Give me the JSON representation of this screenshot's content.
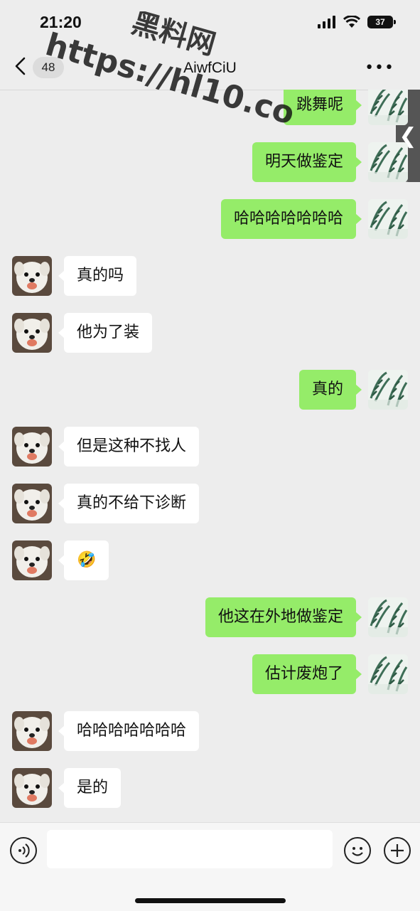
{
  "status": {
    "time": "21:20",
    "battery": "37"
  },
  "nav": {
    "unread_count": "48",
    "title": "AiwfCiU"
  },
  "watermark": {
    "line1": "黑料网",
    "line2": "https://hl10.co"
  },
  "messages": [
    {
      "side": "right",
      "text": "跳舞呢"
    },
    {
      "side": "right",
      "text": "明天做鉴定"
    },
    {
      "side": "right",
      "text": "哈哈哈哈哈哈哈"
    },
    {
      "side": "left",
      "text": "真的吗"
    },
    {
      "side": "left",
      "text": "他为了装"
    },
    {
      "side": "right",
      "text": "真的"
    },
    {
      "side": "left",
      "text": "但是这种不找人"
    },
    {
      "side": "left",
      "text": "真的不给下诊断"
    },
    {
      "side": "left",
      "text": "🤣"
    },
    {
      "side": "right",
      "text": "他这在外地做鉴定"
    },
    {
      "side": "right",
      "text": "估计废炮了"
    },
    {
      "side": "left",
      "text": "哈哈哈哈哈哈哈"
    },
    {
      "side": "left",
      "text": "是的"
    }
  ],
  "input": {
    "placeholder": "",
    "value": ""
  },
  "colors": {
    "sent_bubble": "#95ec69",
    "received_bubble": "#ffffff",
    "background": "#ededed"
  }
}
